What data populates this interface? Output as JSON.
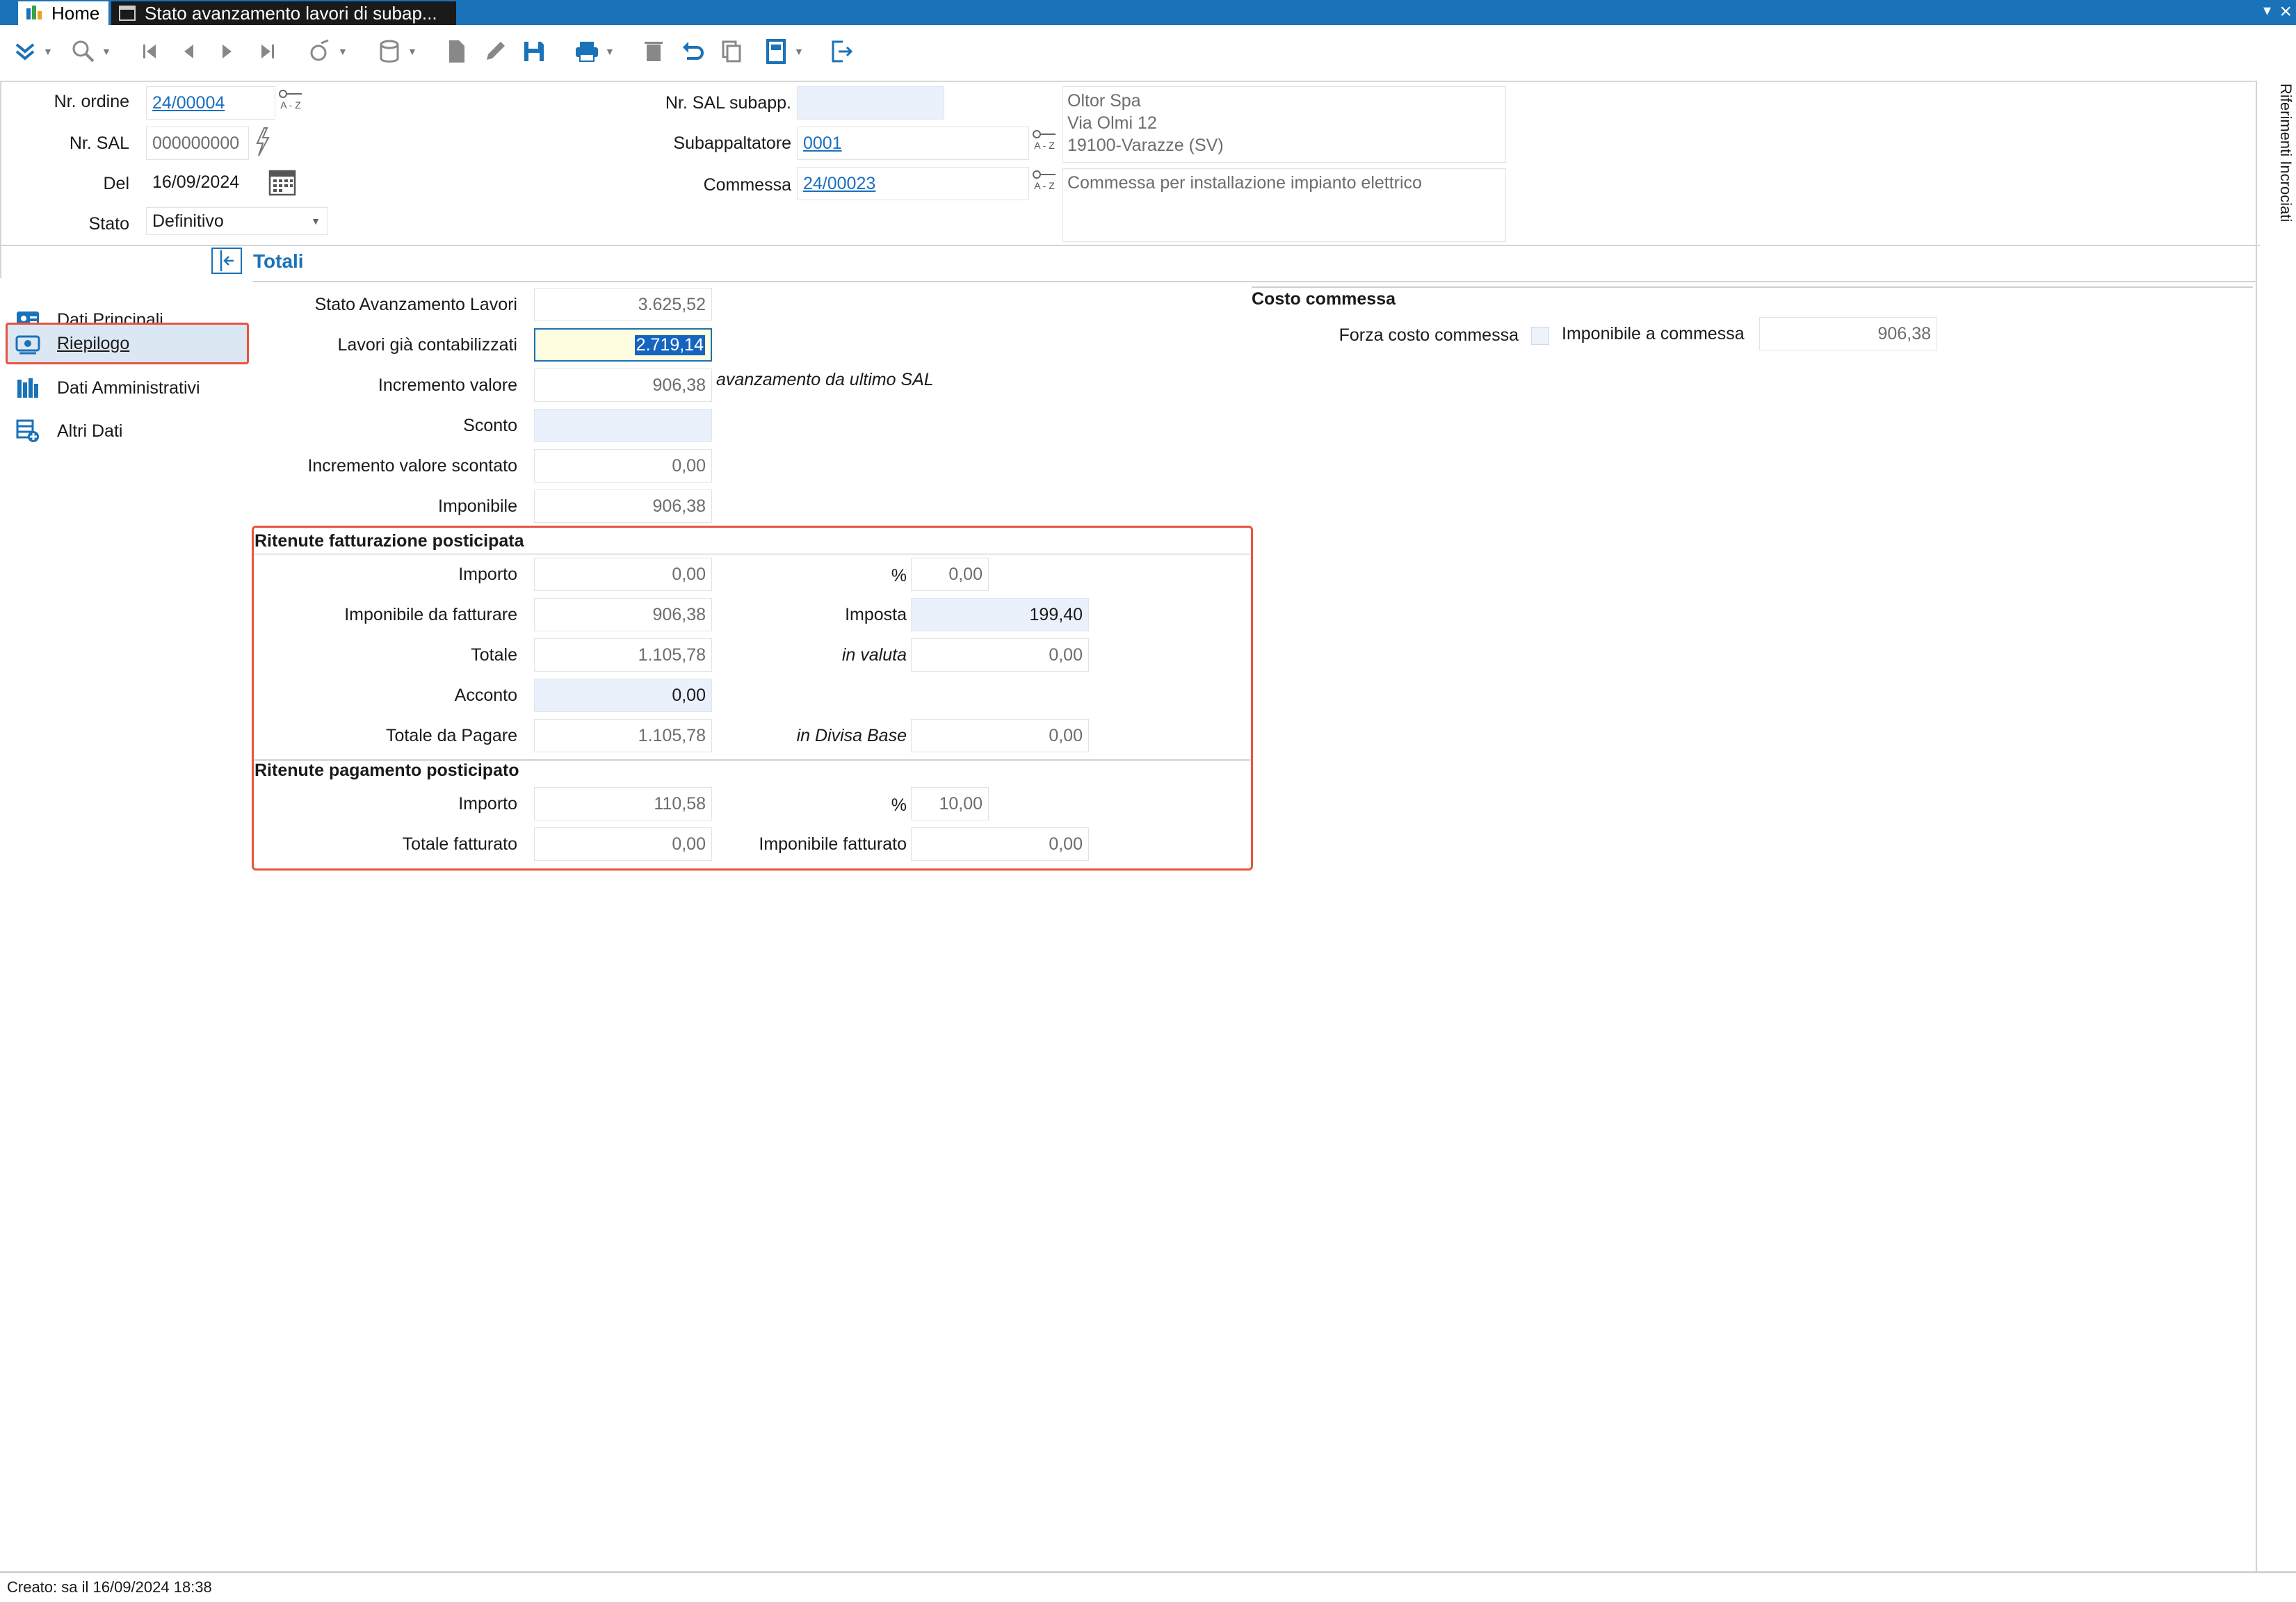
{
  "titlebar": {
    "home_tab": "Home",
    "doc_tab": "Stato avanzamento lavori di subap..."
  },
  "toolbar": {
    "icons": [
      "expand-icon",
      "search-icon",
      "first-record-icon",
      "prev-record-icon",
      "next-record-icon",
      "last-record-icon",
      "scanner-icon",
      "database-icon",
      "new-document-icon",
      "edit-icon",
      "save-icon",
      "print-icon",
      "delete-icon",
      "undo-icon",
      "copy-icon",
      "form-icon",
      "exit-icon"
    ]
  },
  "header": {
    "nr_ordine_label": "Nr. ordine",
    "nr_ordine_value": "24/00004",
    "nr_sal_label": "Nr. SAL",
    "nr_sal_value": "000000000",
    "del_label": "Del",
    "del_value": "16/09/2024",
    "stato_label": "Stato",
    "stato_value": "Definitivo",
    "nr_sal_subapp_label": "Nr. SAL subapp.",
    "nr_sal_subapp_value": "",
    "subappaltatore_label": "Subappaltatore",
    "subappaltatore_value": "0001",
    "commessa_label": "Commessa",
    "commessa_value": "24/00023",
    "sub_addr_line1": "Oltor Spa",
    "sub_addr_line2": "Via Olmi 12",
    "sub_addr_line3": "19100-Varazze (SV)",
    "commessa_desc": "Commessa per installazione impianto elettrico",
    "az_text": "A - Z"
  },
  "side_panel": {
    "label": "Riferimenti Incrociati"
  },
  "section": {
    "title": "Totali"
  },
  "nav": [
    {
      "label": "Dati Principali"
    },
    {
      "label": "Riepilogo"
    },
    {
      "label": "Dati Amministrativi"
    },
    {
      "label": "Altri Dati"
    }
  ],
  "totals": {
    "sal_label": "Stato Avanzamento Lavori",
    "sal_value": "3.625,52",
    "lavori_label": "Lavori già contabilizzati",
    "lavori_value": "2.719,14",
    "incremento_label": "Incremento valore",
    "incremento_value": "906,38",
    "incremento_note": "avanzamento da ultimo SAL",
    "sconto_label": "Sconto",
    "sconto_value": "",
    "incr_scontato_label": "Incremento valore scontato",
    "incr_scontato_value": "0,00",
    "imponibile_label": "Imponibile",
    "imponibile_value": "906,38"
  },
  "ritenute_fatt": {
    "title": "Ritenute fatturazione posticipata",
    "importo_label": "Importo",
    "importo_value": "0,00",
    "perc_label": "%",
    "perc_value": "0,00",
    "imp_fatt_label": "Imponibile da fatturare",
    "imp_fatt_value": "906,38",
    "imposta_label": "Imposta",
    "imposta_value": "199,40",
    "totale_label": "Totale",
    "totale_value": "1.105,78",
    "valuta_label": "in valuta",
    "valuta_value": "0,00",
    "acconto_label": "Acconto",
    "acconto_value": "0,00",
    "tot_pagare_label": "Totale da Pagare",
    "tot_pagare_value": "1.105,78",
    "divisa_label": "in Divisa Base",
    "divisa_value": "0,00"
  },
  "ritenute_pag": {
    "title": "Ritenute pagamento posticipato",
    "importo_label": "Importo",
    "importo_value": "110,58",
    "perc_label": "%",
    "perc_value": "10,00",
    "tot_fatt_label": "Totale fatturato",
    "tot_fatt_value": "0,00",
    "imp_fatt_label": "Imponibile fatturato",
    "imp_fatt_value": "0,00"
  },
  "costo": {
    "title": "Costo commessa",
    "forza_label": "Forza costo commessa",
    "imponibile_label": "Imponibile a commessa",
    "imponibile_value": "906,38"
  },
  "status": {
    "text": "Creato: sa il 16/09/2024 18:38"
  },
  "colors": {
    "accent": "#1a72b8",
    "highlight": "#e8543d",
    "selection": "#1565c0"
  }
}
